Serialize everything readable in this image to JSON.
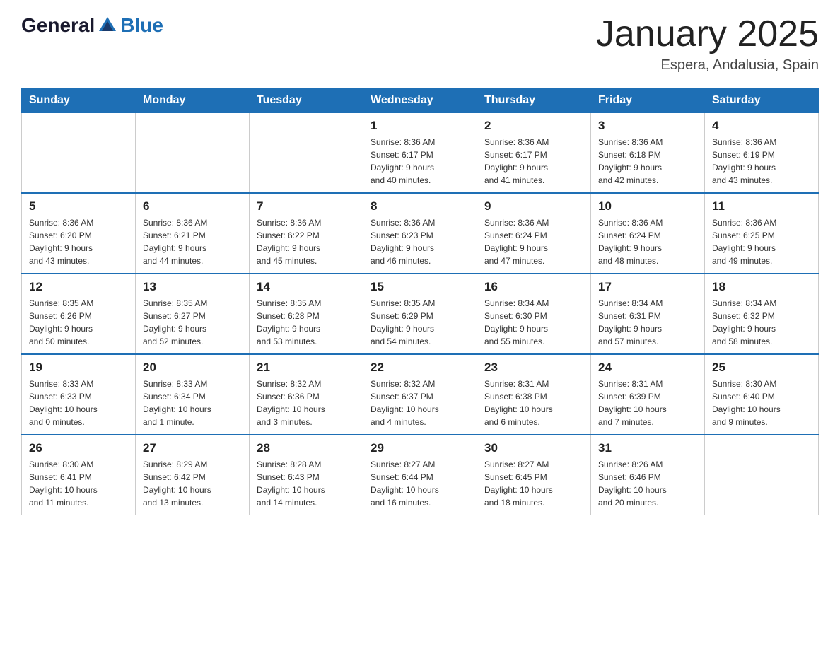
{
  "logo": {
    "general": "General",
    "blue": "Blue"
  },
  "title": "January 2025",
  "subtitle": "Espera, Andalusia, Spain",
  "headers": [
    "Sunday",
    "Monday",
    "Tuesday",
    "Wednesday",
    "Thursday",
    "Friday",
    "Saturday"
  ],
  "weeks": [
    [
      {
        "day": "",
        "info": ""
      },
      {
        "day": "",
        "info": ""
      },
      {
        "day": "",
        "info": ""
      },
      {
        "day": "1",
        "info": "Sunrise: 8:36 AM\nSunset: 6:17 PM\nDaylight: 9 hours\nand 40 minutes."
      },
      {
        "day": "2",
        "info": "Sunrise: 8:36 AM\nSunset: 6:17 PM\nDaylight: 9 hours\nand 41 minutes."
      },
      {
        "day": "3",
        "info": "Sunrise: 8:36 AM\nSunset: 6:18 PM\nDaylight: 9 hours\nand 42 minutes."
      },
      {
        "day": "4",
        "info": "Sunrise: 8:36 AM\nSunset: 6:19 PM\nDaylight: 9 hours\nand 43 minutes."
      }
    ],
    [
      {
        "day": "5",
        "info": "Sunrise: 8:36 AM\nSunset: 6:20 PM\nDaylight: 9 hours\nand 43 minutes."
      },
      {
        "day": "6",
        "info": "Sunrise: 8:36 AM\nSunset: 6:21 PM\nDaylight: 9 hours\nand 44 minutes."
      },
      {
        "day": "7",
        "info": "Sunrise: 8:36 AM\nSunset: 6:22 PM\nDaylight: 9 hours\nand 45 minutes."
      },
      {
        "day": "8",
        "info": "Sunrise: 8:36 AM\nSunset: 6:23 PM\nDaylight: 9 hours\nand 46 minutes."
      },
      {
        "day": "9",
        "info": "Sunrise: 8:36 AM\nSunset: 6:24 PM\nDaylight: 9 hours\nand 47 minutes."
      },
      {
        "day": "10",
        "info": "Sunrise: 8:36 AM\nSunset: 6:24 PM\nDaylight: 9 hours\nand 48 minutes."
      },
      {
        "day": "11",
        "info": "Sunrise: 8:36 AM\nSunset: 6:25 PM\nDaylight: 9 hours\nand 49 minutes."
      }
    ],
    [
      {
        "day": "12",
        "info": "Sunrise: 8:35 AM\nSunset: 6:26 PM\nDaylight: 9 hours\nand 50 minutes."
      },
      {
        "day": "13",
        "info": "Sunrise: 8:35 AM\nSunset: 6:27 PM\nDaylight: 9 hours\nand 52 minutes."
      },
      {
        "day": "14",
        "info": "Sunrise: 8:35 AM\nSunset: 6:28 PM\nDaylight: 9 hours\nand 53 minutes."
      },
      {
        "day": "15",
        "info": "Sunrise: 8:35 AM\nSunset: 6:29 PM\nDaylight: 9 hours\nand 54 minutes."
      },
      {
        "day": "16",
        "info": "Sunrise: 8:34 AM\nSunset: 6:30 PM\nDaylight: 9 hours\nand 55 minutes."
      },
      {
        "day": "17",
        "info": "Sunrise: 8:34 AM\nSunset: 6:31 PM\nDaylight: 9 hours\nand 57 minutes."
      },
      {
        "day": "18",
        "info": "Sunrise: 8:34 AM\nSunset: 6:32 PM\nDaylight: 9 hours\nand 58 minutes."
      }
    ],
    [
      {
        "day": "19",
        "info": "Sunrise: 8:33 AM\nSunset: 6:33 PM\nDaylight: 10 hours\nand 0 minutes."
      },
      {
        "day": "20",
        "info": "Sunrise: 8:33 AM\nSunset: 6:34 PM\nDaylight: 10 hours\nand 1 minute."
      },
      {
        "day": "21",
        "info": "Sunrise: 8:32 AM\nSunset: 6:36 PM\nDaylight: 10 hours\nand 3 minutes."
      },
      {
        "day": "22",
        "info": "Sunrise: 8:32 AM\nSunset: 6:37 PM\nDaylight: 10 hours\nand 4 minutes."
      },
      {
        "day": "23",
        "info": "Sunrise: 8:31 AM\nSunset: 6:38 PM\nDaylight: 10 hours\nand 6 minutes."
      },
      {
        "day": "24",
        "info": "Sunrise: 8:31 AM\nSunset: 6:39 PM\nDaylight: 10 hours\nand 7 minutes."
      },
      {
        "day": "25",
        "info": "Sunrise: 8:30 AM\nSunset: 6:40 PM\nDaylight: 10 hours\nand 9 minutes."
      }
    ],
    [
      {
        "day": "26",
        "info": "Sunrise: 8:30 AM\nSunset: 6:41 PM\nDaylight: 10 hours\nand 11 minutes."
      },
      {
        "day": "27",
        "info": "Sunrise: 8:29 AM\nSunset: 6:42 PM\nDaylight: 10 hours\nand 13 minutes."
      },
      {
        "day": "28",
        "info": "Sunrise: 8:28 AM\nSunset: 6:43 PM\nDaylight: 10 hours\nand 14 minutes."
      },
      {
        "day": "29",
        "info": "Sunrise: 8:27 AM\nSunset: 6:44 PM\nDaylight: 10 hours\nand 16 minutes."
      },
      {
        "day": "30",
        "info": "Sunrise: 8:27 AM\nSunset: 6:45 PM\nDaylight: 10 hours\nand 18 minutes."
      },
      {
        "day": "31",
        "info": "Sunrise: 8:26 AM\nSunset: 6:46 PM\nDaylight: 10 hours\nand 20 minutes."
      },
      {
        "day": "",
        "info": ""
      }
    ]
  ]
}
